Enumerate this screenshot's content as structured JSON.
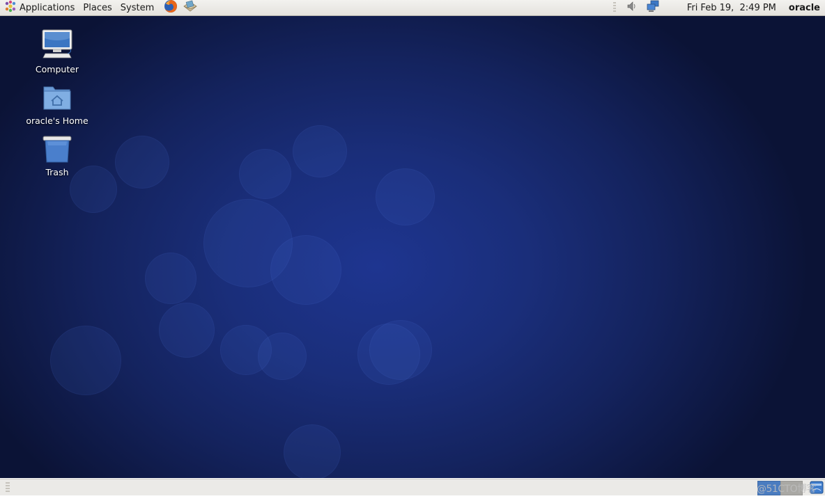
{
  "top_panel": {
    "menus": [
      {
        "label": "Applications",
        "icon": "gnome-foot-icon"
      },
      {
        "label": "Places"
      },
      {
        "label": "System"
      }
    ],
    "launchers": [
      {
        "name": "firefox",
        "icon": "firefox-icon"
      },
      {
        "name": "mail",
        "icon": "mail-icon"
      }
    ],
    "tray": [
      {
        "name": "volume",
        "icon": "volume-icon"
      },
      {
        "name": "network",
        "icon": "network-icon"
      }
    ],
    "clock": "Fri Feb 19,  2:49 PM",
    "user": "oracle"
  },
  "desktop": {
    "icons": [
      {
        "label": "Computer",
        "icon": "computer-icon"
      },
      {
        "label": "oracle's Home",
        "icon": "home-folder-icon"
      },
      {
        "label": "Trash",
        "icon": "trash-icon"
      }
    ]
  },
  "bottom_panel": {
    "workspaces": [
      {
        "index": 1,
        "active": true
      },
      {
        "index": 2,
        "active": false
      }
    ],
    "show_desktop": "show-desktop-icon"
  },
  "watermark": "@51CTO博客",
  "colors": {
    "panel_bg": "#e9e8e4",
    "wallpaper_center": "#1e3590",
    "wallpaper_edge": "#0b1336",
    "workspace_active": "#4a7cc0"
  }
}
